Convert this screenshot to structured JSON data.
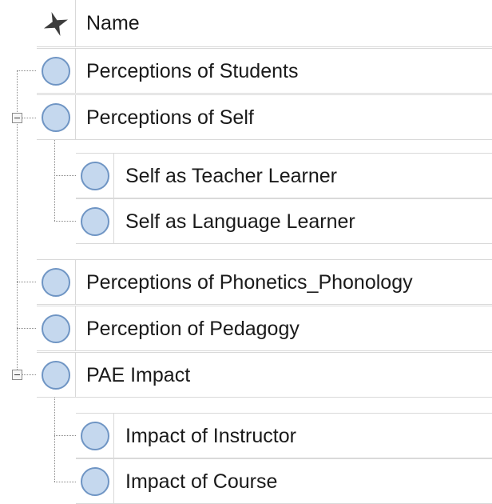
{
  "header": {
    "name_label": "Name",
    "icon": "nodes-star-icon"
  },
  "nodes": [
    {
      "label": "Perceptions of Students",
      "level": 0,
      "icon": "node-circle-icon"
    },
    {
      "label": "Perceptions of Self",
      "level": 0,
      "icon": "node-circle-icon",
      "expanded": true
    },
    {
      "label": "Self as Teacher Learner",
      "level": 1,
      "icon": "node-circle-icon"
    },
    {
      "label": "Self as Language Learner",
      "level": 1,
      "icon": "node-circle-icon"
    },
    {
      "label": "Perceptions of Phonetics_Phonology",
      "level": 0,
      "icon": "node-circle-icon"
    },
    {
      "label": "Perception of Pedagogy",
      "level": 0,
      "icon": "node-circle-icon"
    },
    {
      "label": "PAE Impact",
      "level": 0,
      "icon": "node-circle-icon",
      "expanded": true
    },
    {
      "label": "Impact of Instructor",
      "level": 1,
      "icon": "node-circle-icon"
    },
    {
      "label": "Impact of Course",
      "level": 1,
      "icon": "node-circle-icon"
    }
  ],
  "colors": {
    "node_fill": "#c5d8ee",
    "node_stroke": "#6f95c4",
    "grid": "#d9d9d9",
    "connector": "#8a8a8a"
  }
}
